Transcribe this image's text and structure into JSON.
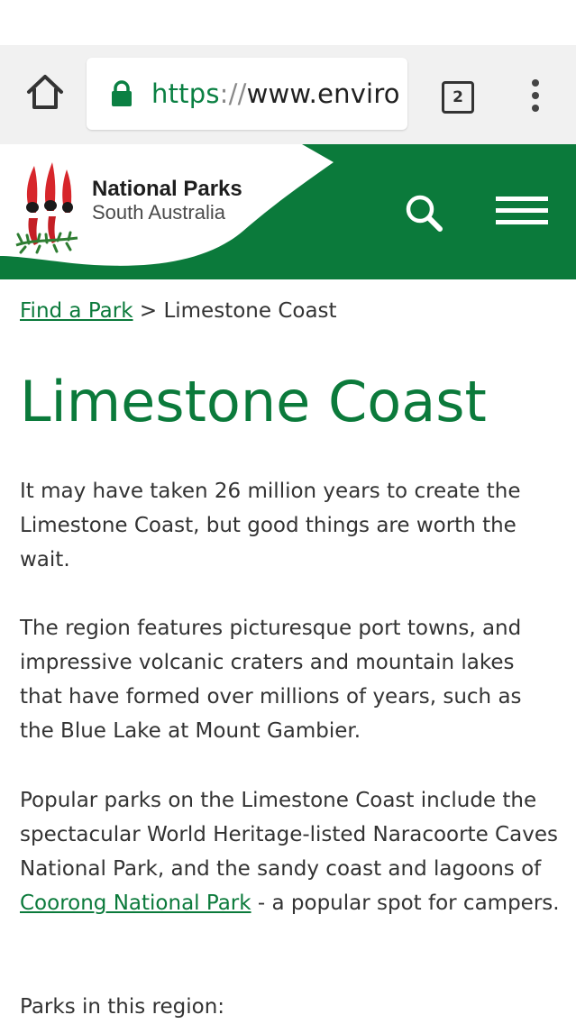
{
  "browser": {
    "url_scheme": "https",
    "url_separator": "://",
    "url_rest": "www.enviro",
    "tab_count": "2"
  },
  "brand": {
    "title": "National Parks",
    "subtitle": "South Australia"
  },
  "breadcrumb": {
    "link_label": "Find a Park",
    "separator": ">",
    "current": "Limestone Coast"
  },
  "page": {
    "title": "Limestone Coast",
    "paragraph1": "It may have taken 26 million years to create the Limestone Coast, but good things are worth the wait.",
    "paragraph2": "The region features picturesque port towns, and impressive volcanic craters and mountain lakes that have formed over millions of years, such as the Blue Lake at Mount Gambier.",
    "paragraph3_before": "Popular parks on the Limestone Coast include the spectacular World Heritage-listed Naracoorte Caves National Park, and the sandy coast and lagoons of ",
    "paragraph3_link": "Coorong National Park",
    "paragraph3_after": " - a popular spot for campers.",
    "parks_heading": "Parks in this region:"
  },
  "colors": {
    "brand_green": "#0b7a3b",
    "url_green": "#0b8043",
    "flower_red": "#d7262b"
  },
  "icons": [
    "home-icon",
    "lock-icon",
    "tabs-icon",
    "overflow-menu-icon",
    "search-icon",
    "hamburger-icon",
    "sturt-desert-pea-logo-icon"
  ]
}
